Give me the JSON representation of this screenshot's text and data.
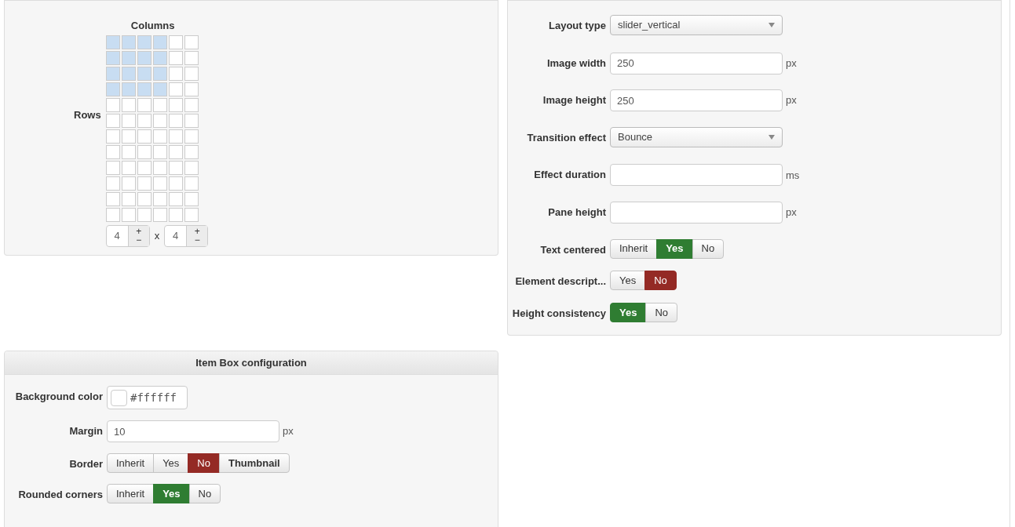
{
  "grid_panel": {
    "columns_label": "Columns",
    "rows_label": "Rows",
    "grid_rows": [
      {
        "cells": [
          {
            "selected": true
          },
          {
            "selected": true
          },
          {
            "selected": true
          },
          {
            "selected": true
          },
          {
            "selected": false
          },
          {
            "selected": false
          }
        ]
      },
      {
        "cells": [
          {
            "selected": true
          },
          {
            "selected": true
          },
          {
            "selected": true
          },
          {
            "selected": true
          },
          {
            "selected": false
          },
          {
            "selected": false
          }
        ]
      },
      {
        "cells": [
          {
            "selected": true
          },
          {
            "selected": true
          },
          {
            "selected": true
          },
          {
            "selected": true
          },
          {
            "selected": false
          },
          {
            "selected": false
          }
        ]
      },
      {
        "cells": [
          {
            "selected": true
          },
          {
            "selected": true
          },
          {
            "selected": true
          },
          {
            "selected": true
          },
          {
            "selected": false
          },
          {
            "selected": false
          }
        ]
      },
      {
        "cells": [
          {
            "selected": false
          },
          {
            "selected": false
          },
          {
            "selected": false
          },
          {
            "selected": false
          },
          {
            "selected": false
          },
          {
            "selected": false
          }
        ]
      },
      {
        "cells": [
          {
            "selected": false
          },
          {
            "selected": false
          },
          {
            "selected": false
          },
          {
            "selected": false
          },
          {
            "selected": false
          },
          {
            "selected": false
          }
        ]
      },
      {
        "cells": [
          {
            "selected": false
          },
          {
            "selected": false
          },
          {
            "selected": false
          },
          {
            "selected": false
          },
          {
            "selected": false
          },
          {
            "selected": false
          }
        ]
      },
      {
        "cells": [
          {
            "selected": false
          },
          {
            "selected": false
          },
          {
            "selected": false
          },
          {
            "selected": false
          },
          {
            "selected": false
          },
          {
            "selected": false
          }
        ]
      },
      {
        "cells": [
          {
            "selected": false
          },
          {
            "selected": false
          },
          {
            "selected": false
          },
          {
            "selected": false
          },
          {
            "selected": false
          },
          {
            "selected": false
          }
        ]
      },
      {
        "cells": [
          {
            "selected": false
          },
          {
            "selected": false
          },
          {
            "selected": false
          },
          {
            "selected": false
          },
          {
            "selected": false
          },
          {
            "selected": false
          }
        ]
      },
      {
        "cells": [
          {
            "selected": false
          },
          {
            "selected": false
          },
          {
            "selected": false
          },
          {
            "selected": false
          },
          {
            "selected": false
          },
          {
            "selected": false
          }
        ]
      },
      {
        "cells": [
          {
            "selected": false
          },
          {
            "selected": false
          },
          {
            "selected": false
          },
          {
            "selected": false
          },
          {
            "selected": false
          },
          {
            "selected": false
          }
        ]
      }
    ],
    "rows_value": "4",
    "separator": "x",
    "columns_value": "4",
    "plus": "+",
    "minus": "−"
  },
  "settings_panel": {
    "fields": [
      {
        "kind": "select",
        "label": "Layout type",
        "value": "slider_vertical"
      },
      {
        "kind": "input",
        "label": "Image width",
        "value": "250",
        "unit": "px"
      },
      {
        "kind": "input",
        "label": "Image height",
        "value": "250",
        "unit": "px"
      },
      {
        "kind": "select",
        "label": "Transition effect",
        "value": "Bounce"
      },
      {
        "kind": "input",
        "label": "Effect duration",
        "unit": "ms"
      },
      {
        "kind": "input",
        "label": "Pane height",
        "unit": "px"
      },
      {
        "kind": "toggle",
        "label": "Text centered",
        "options": [
          {
            "label": "Inherit",
            "selected": false,
            "kind": "neutral"
          },
          {
            "label": "Yes",
            "selected": true,
            "kind": "positive"
          },
          {
            "label": "No",
            "selected": false,
            "kind": "negative"
          }
        ]
      },
      {
        "kind": "toggle",
        "label": "Element descript...",
        "options": [
          {
            "label": "Yes",
            "selected": false,
            "kind": "positive"
          },
          {
            "label": "No",
            "selected": true,
            "kind": "negative"
          }
        ]
      },
      {
        "kind": "toggle",
        "label": "Height consistency",
        "options": [
          {
            "label": "Yes",
            "selected": true,
            "kind": "positive"
          },
          {
            "label": "No",
            "selected": false,
            "kind": "negative"
          }
        ]
      }
    ]
  },
  "item_box_panel": {
    "title": "Item Box configuration",
    "fields": [
      {
        "kind": "color",
        "label": "Background color",
        "value": "#ffffff"
      },
      {
        "kind": "input",
        "label": "Margin",
        "value": "10",
        "unit": "px"
      },
      {
        "kind": "toggle",
        "label": "Border",
        "options": [
          {
            "label": "Inherit",
            "selected": false,
            "kind": "neutral"
          },
          {
            "label": "Yes",
            "selected": false,
            "kind": "positive"
          },
          {
            "label": "No",
            "selected": true,
            "kind": "negative"
          },
          {
            "label": "Thumbnail",
            "selected": false,
            "kind": "emphasis"
          }
        ]
      },
      {
        "kind": "toggle",
        "label": "Rounded corners",
        "options": [
          {
            "label": "Inherit",
            "selected": false,
            "kind": "neutral"
          },
          {
            "label": "Yes",
            "selected": true,
            "kind": "positive"
          },
          {
            "label": "No",
            "selected": false,
            "kind": "negative"
          }
        ]
      }
    ]
  }
}
